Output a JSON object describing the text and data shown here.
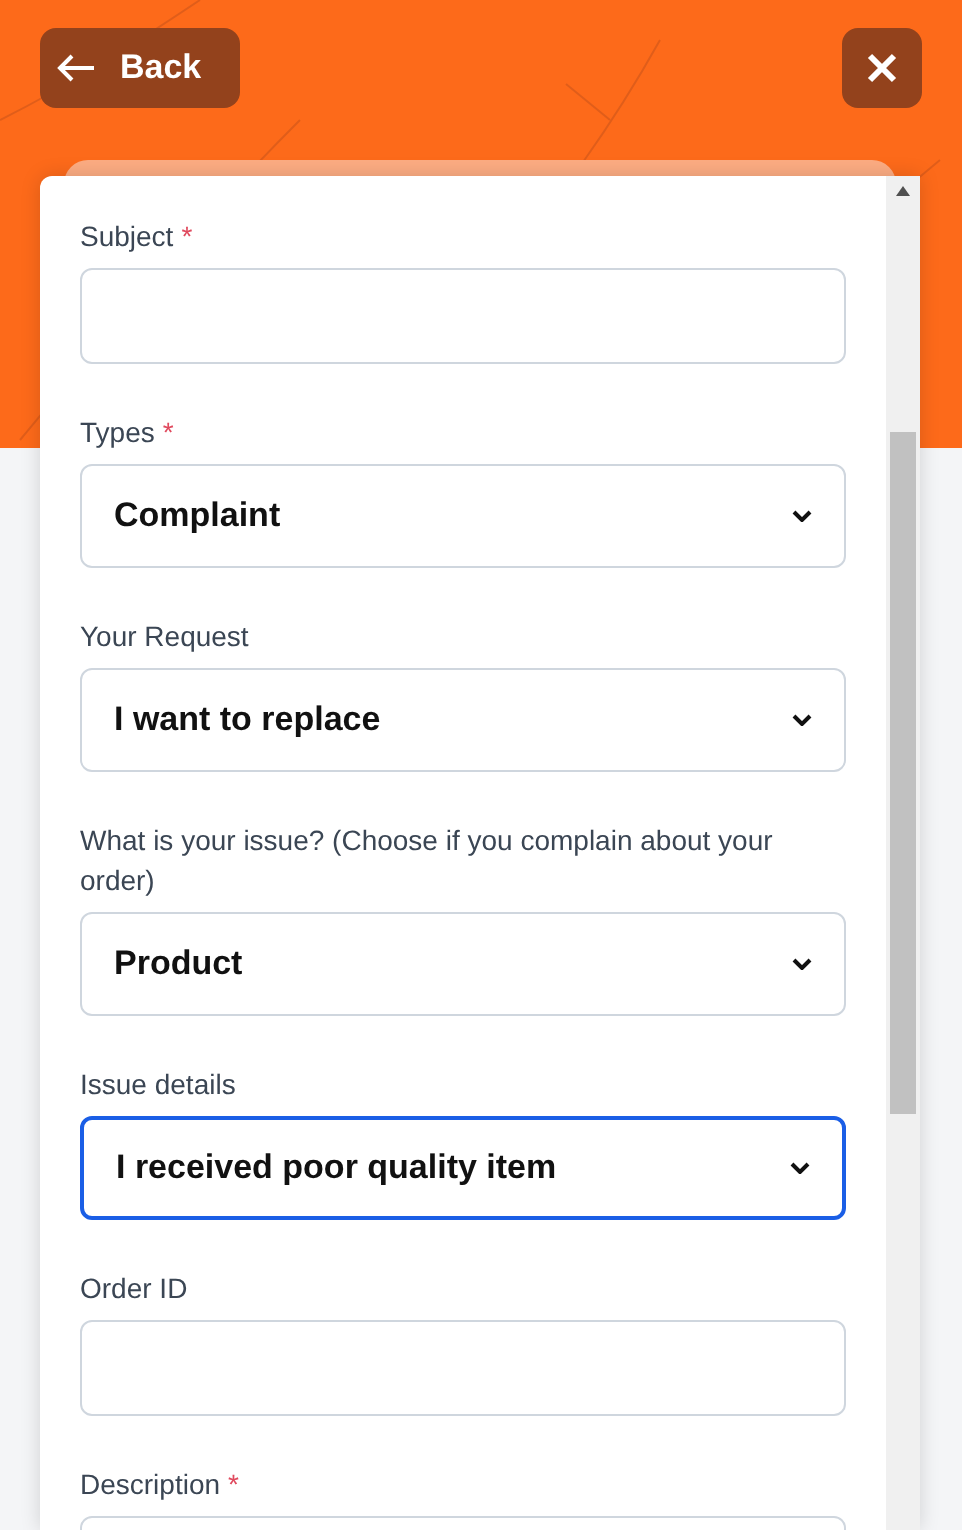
{
  "header": {
    "back_button": {
      "label": "Back"
    }
  },
  "form": {
    "fields": [
      {
        "kind": "text",
        "label": "Subject",
        "marker": "*",
        "focused": false
      },
      {
        "kind": "select",
        "label": "Types",
        "marker": "*",
        "value": "Complaint",
        "focused": false
      },
      {
        "kind": "select",
        "label": "Your Request",
        "value": "I want to replace",
        "focused": false
      },
      {
        "kind": "select",
        "label": "What is your issue? (Choose if you complain about your order)",
        "value": "Product",
        "focused": false
      },
      {
        "kind": "select",
        "label": "Issue details",
        "value": "I received poor quality item",
        "focused": true
      },
      {
        "kind": "text",
        "label": "Order ID",
        "focused": false
      },
      {
        "kind": "text",
        "label": "Description",
        "marker": "*",
        "focused": false
      }
    ]
  }
}
